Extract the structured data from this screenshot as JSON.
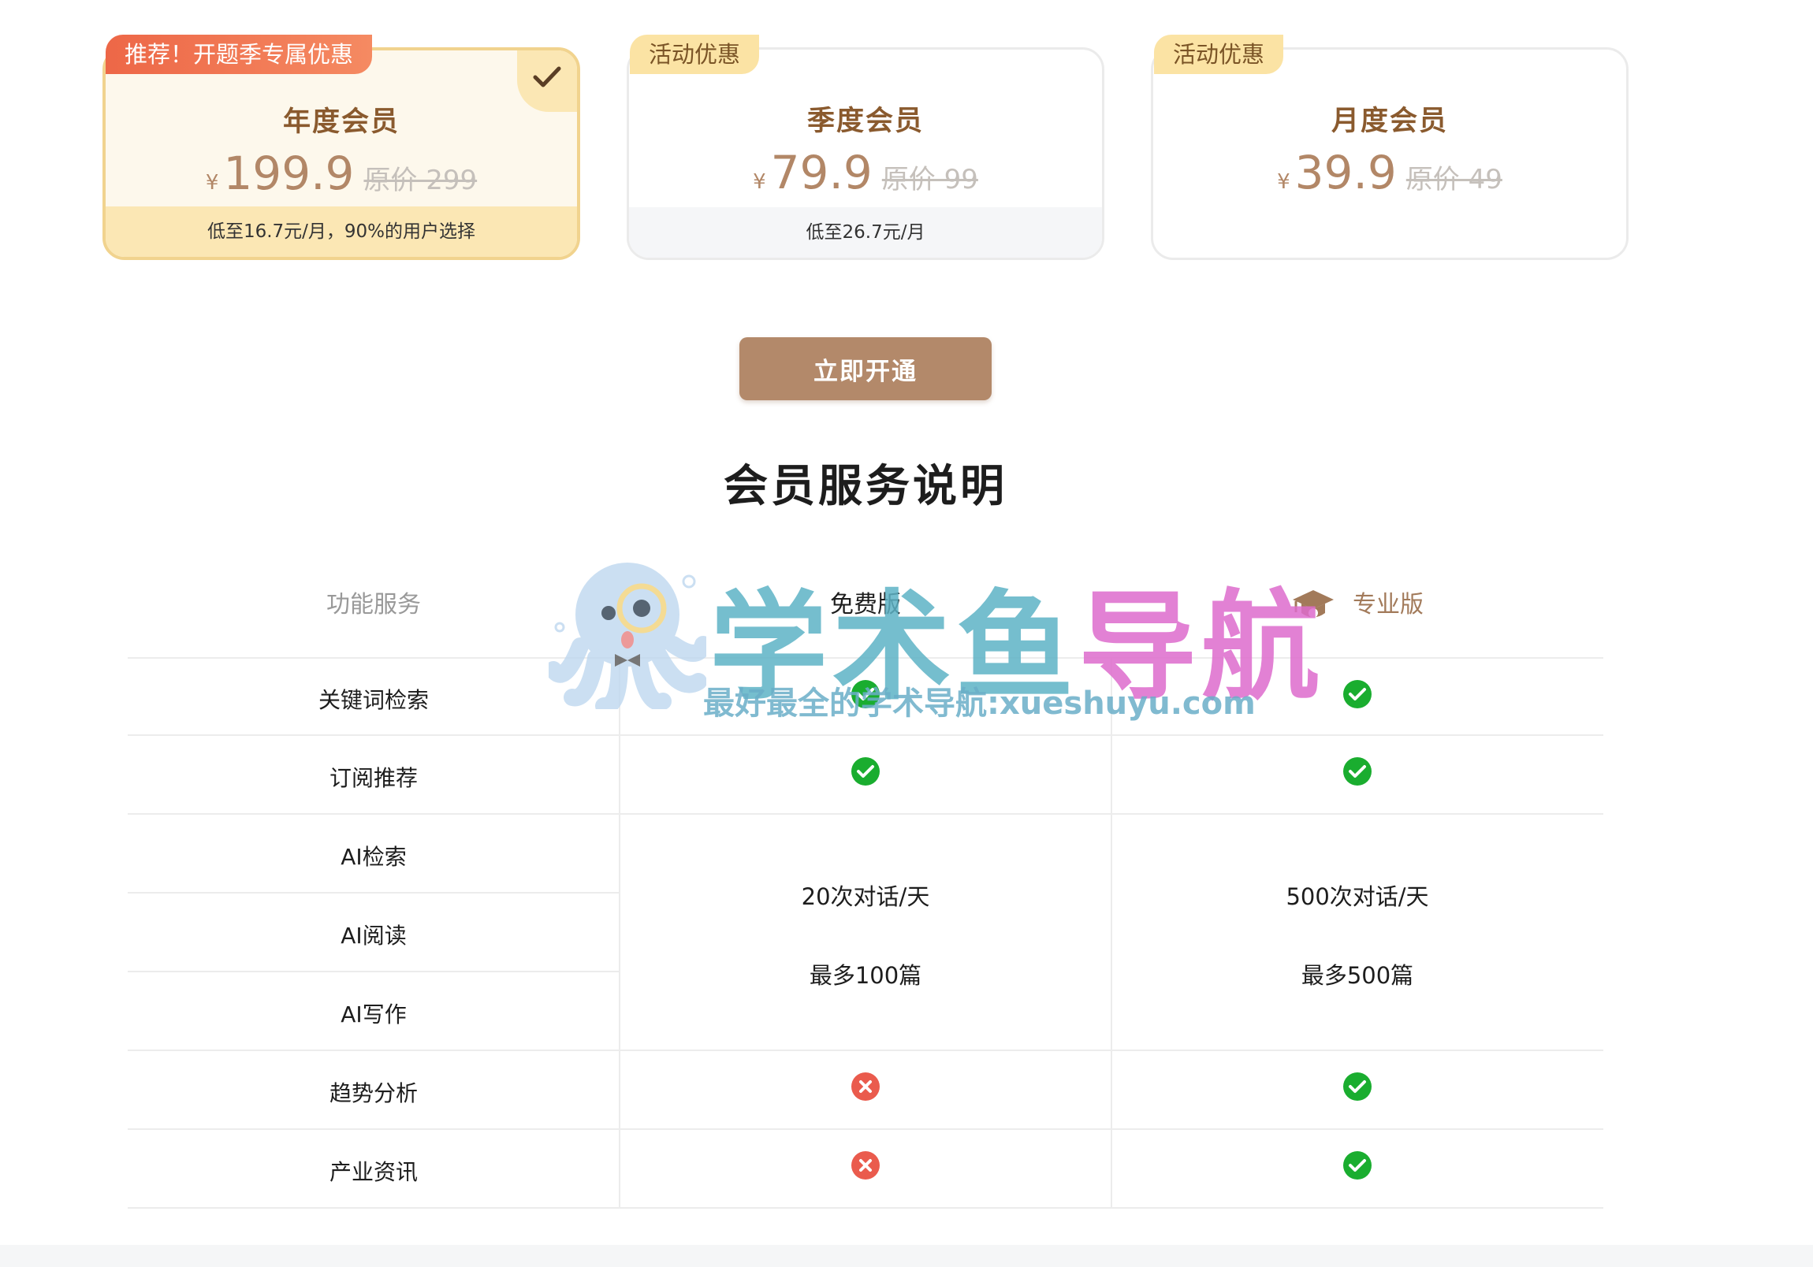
{
  "plans": [
    {
      "tag": "推荐！开题季专属优惠",
      "name": "年度会员",
      "currency": "¥",
      "price": "199.9",
      "original": "原价 299",
      "note": "低至16.7元/月，90%的用户选择",
      "selected": true
    },
    {
      "tag": "活动优惠",
      "name": "季度会员",
      "currency": "¥",
      "price": "79.9",
      "original": "原价 99",
      "note": "低至26.7元/月",
      "selected": false
    },
    {
      "tag": "活动优惠",
      "name": "月度会员",
      "currency": "¥",
      "price": "39.9",
      "original": "原价 49",
      "note": "",
      "selected": false
    }
  ],
  "cta_label": "立即开通",
  "section_title": "会员服务说明",
  "table": {
    "headers": {
      "feature": "功能服务",
      "free": "免费版",
      "pro": "专业版"
    },
    "rows": [
      {
        "feature": "关键词检索",
        "free": "check",
        "pro": "check"
      },
      {
        "feature": "订阅推荐",
        "free": "check",
        "pro": "check"
      },
      {
        "feature": "AI检索"
      },
      {
        "feature": "AI阅读"
      },
      {
        "feature": "AI写作"
      },
      {
        "feature": "趋势分析",
        "free": "cross",
        "pro": "check"
      },
      {
        "feature": "产业资讯",
        "free": "cross",
        "pro": "check"
      }
    ],
    "ai_merged": {
      "free_line1": "20次对话/天",
      "free_line2": "最多100篇",
      "pro_line1": "500次对话/天",
      "pro_line2": "最多500篇"
    }
  },
  "watermark": {
    "title_part1": "学术鱼",
    "title_part2": "导航",
    "subtitle": "最好最全的学术导航:xueshuyu.com"
  },
  "colors": {
    "accent_brown": "#b3896a",
    "card_gold_border": "#f1d38e",
    "check_green": "#1aad2f",
    "cross_red": "#ea5b4d"
  },
  "icons": {
    "selected_mark": "check-mark-icon",
    "pro_header": "graduation-cap-icon",
    "available": "green-check-circle-icon",
    "unavailable": "red-cross-circle-icon"
  }
}
